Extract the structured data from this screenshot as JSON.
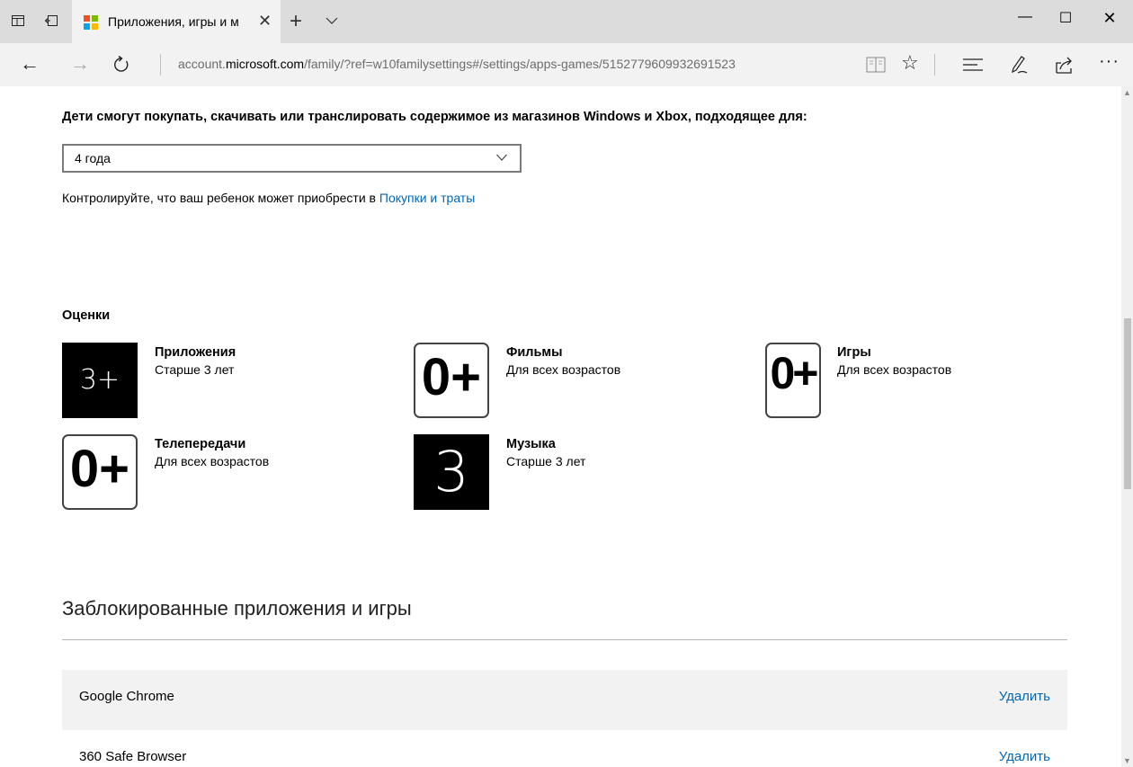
{
  "browser": {
    "tab": {
      "title": "Приложения, игры и м"
    },
    "address": {
      "url_prefix": "account.",
      "url_domain": "microsoft.com",
      "url_path": "/family/?ref=w10familysettings#/settings/apps-games/5152779609932691523"
    }
  },
  "settings": {
    "purchase_heading": "Дети смогут покупать, скачивать или транслировать содержимое из магазинов Windows и Xbox, подходящее для:",
    "age_select": {
      "value": "4 года"
    },
    "control_text": "Контролируйте, что ваш ребенок может приобрести в",
    "control_link": "Покупки и траты"
  },
  "ratings": {
    "title": "Оценки",
    "items": [
      {
        "badge": "3+",
        "title": "Приложения",
        "desc": "Старше 3 лет"
      },
      {
        "badge": "0+",
        "title": "Фильмы",
        "desc": "Для всех возрастов"
      },
      {
        "badge": "0+",
        "title": "Игры",
        "desc": "Для всех возрастов"
      },
      {
        "badge": "0+",
        "title": "Телепередачи",
        "desc": "Для всех возрастов"
      },
      {
        "badge": "3",
        "title": "Музыка",
        "desc": "Старше 3 лет"
      }
    ]
  },
  "blocked": {
    "title": "Заблокированные приложения и игры",
    "apps": [
      {
        "name": "Google Chrome",
        "action": "Удалить"
      },
      {
        "name": "360 Safe Browser",
        "action": "Удалить"
      }
    ]
  },
  "colors": {
    "link": "#0067b8",
    "titlebar": "#dcdcdc",
    "tab_active": "#f2f2f2"
  },
  "icons": [
    "tab-preview-icon",
    "set-aside-tabs-icon",
    "microsoft-logo-icon",
    "close-icon",
    "plus-icon",
    "chevron-down-icon",
    "back-arrow-icon",
    "forward-arrow-icon",
    "refresh-icon",
    "reading-view-icon",
    "star-icon",
    "hub-icon",
    "web-note-icon",
    "share-icon",
    "more-icon"
  ]
}
